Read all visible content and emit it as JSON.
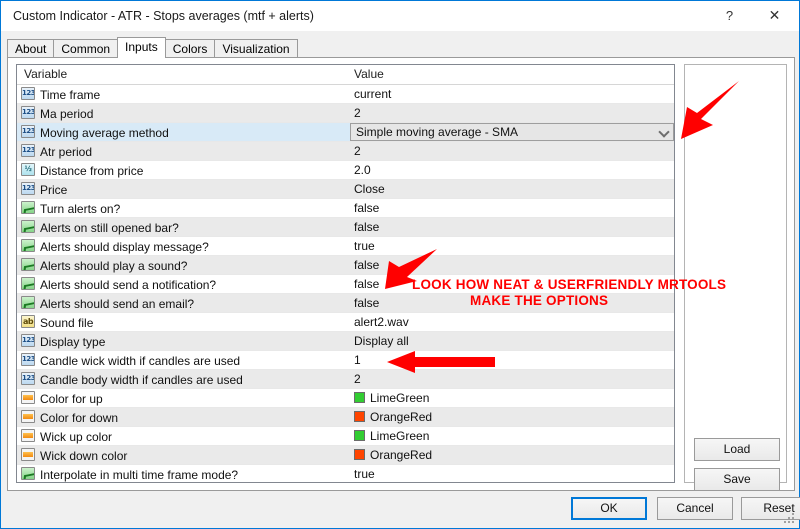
{
  "window": {
    "title": "Custom Indicator - ATR - Stops averages (mtf + alerts)",
    "help_label": "?",
    "close_label": "✕"
  },
  "tabs": [
    {
      "label": "About",
      "active": false
    },
    {
      "label": "Common",
      "active": false
    },
    {
      "label": "Inputs",
      "active": true
    },
    {
      "label": "Colors",
      "active": false
    },
    {
      "label": "Visualization",
      "active": false
    }
  ],
  "grid": {
    "headers": {
      "variable": "Variable",
      "value": "Value"
    },
    "rows": [
      {
        "icon": "int-icon",
        "icon_glyph": "123",
        "name": "Time frame",
        "value": "current"
      },
      {
        "icon": "int-icon",
        "icon_glyph": "123",
        "name": "Ma period",
        "value": "2"
      },
      {
        "icon": "int-icon",
        "icon_glyph": "123",
        "name": "Moving average method",
        "value": "Simple moving average - SMA",
        "editor": "combo",
        "selected": true
      },
      {
        "icon": "int-icon",
        "icon_glyph": "123",
        "name": "Atr period",
        "value": "2"
      },
      {
        "icon": "double-icon",
        "icon_glyph": "½",
        "name": "Distance from price",
        "value": "2.0"
      },
      {
        "icon": "int-icon",
        "icon_glyph": "123",
        "name": "Price",
        "value": "Close"
      },
      {
        "icon": "bool-icon",
        "icon_glyph": "",
        "name": "Turn alerts on?",
        "value": "false"
      },
      {
        "icon": "bool-icon",
        "icon_glyph": "",
        "name": "Alerts on still opened bar?",
        "value": "false"
      },
      {
        "icon": "bool-icon",
        "icon_glyph": "",
        "name": "Alerts should display message?",
        "value": "true"
      },
      {
        "icon": "bool-icon",
        "icon_glyph": "",
        "name": "Alerts should play a sound?",
        "value": "false"
      },
      {
        "icon": "bool-icon",
        "icon_glyph": "",
        "name": "Alerts should send a notification?",
        "value": "false"
      },
      {
        "icon": "bool-icon",
        "icon_glyph": "",
        "name": "Alerts should send an email?",
        "value": "false"
      },
      {
        "icon": "string-icon",
        "icon_glyph": "ab",
        "name": "Sound file",
        "value": "alert2.wav"
      },
      {
        "icon": "int-icon",
        "icon_glyph": "123",
        "name": "Display type",
        "value": "Display all"
      },
      {
        "icon": "int-icon",
        "icon_glyph": "123",
        "name": "Candle wick width if candles are used",
        "value": "1"
      },
      {
        "icon": "int-icon",
        "icon_glyph": "123",
        "name": "Candle body width if candles are used",
        "value": "2"
      },
      {
        "icon": "color-icon",
        "icon_glyph": "",
        "name": "Color for up",
        "value": "LimeGreen",
        "swatch": "#32CD32"
      },
      {
        "icon": "color-icon",
        "icon_glyph": "",
        "name": "Color for down",
        "value": "OrangeRed",
        "swatch": "#FF4500"
      },
      {
        "icon": "color-icon",
        "icon_glyph": "",
        "name": "Wick up color",
        "value": "LimeGreen",
        "swatch": "#32CD32"
      },
      {
        "icon": "color-icon",
        "icon_glyph": "",
        "name": "Wick down color",
        "value": "OrangeRed",
        "swatch": "#FF4500"
      },
      {
        "icon": "bool-icon",
        "icon_glyph": "",
        "name": "Interpolate in multi time frame mode?",
        "value": "true"
      }
    ]
  },
  "side_panel": {
    "load_label": "Load",
    "save_label": "Save"
  },
  "footer": {
    "ok_label": "OK",
    "cancel_label": "Cancel",
    "reset_label": "Reset"
  },
  "annotations": {
    "line1": "LOOK HOW NEAT & USERFRIENDLY MRTOOLS",
    "line2": "MAKE THE OPTIONS",
    "color": "#FF0000"
  }
}
